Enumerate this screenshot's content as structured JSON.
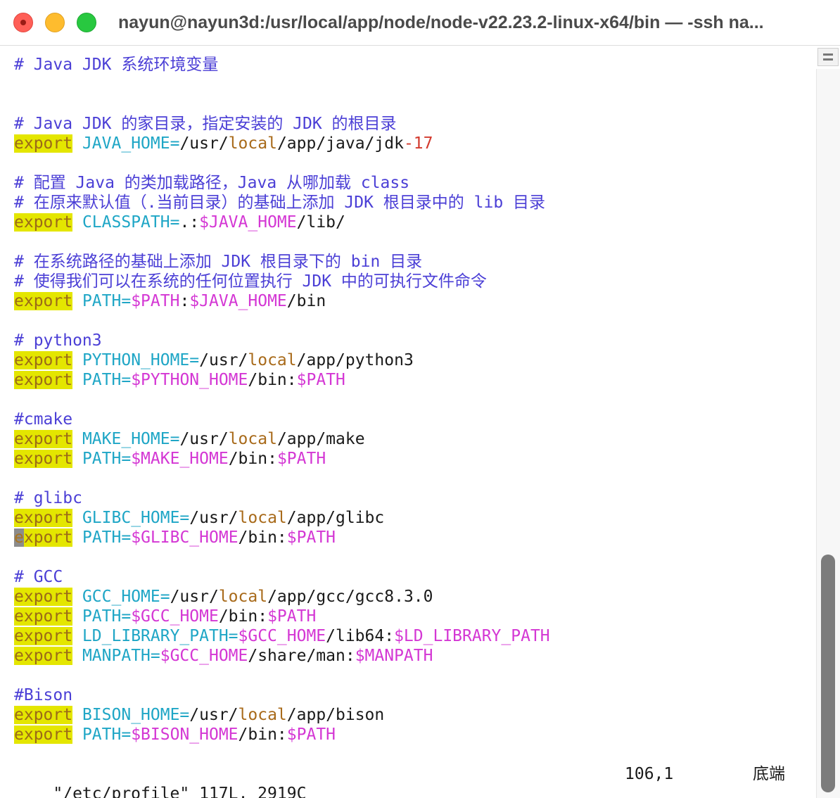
{
  "window": {
    "title": "nayun@nayun3d:/usr/local/app/node/node-v22.23.2-linux-x64/bin — -ssh na..."
  },
  "editor": {
    "lines": [
      [
        {
          "t": "# Java JDK 系统环境变量",
          "k": "c"
        }
      ],
      [],
      [],
      [
        {
          "t": "# Java JDK 的家目录，指定安装的 JDK 的根目录",
          "k": "c"
        }
      ],
      [
        {
          "t": "export",
          "k": "kw"
        },
        {
          "t": " "
        },
        {
          "t": "JAVA_HOME=",
          "k": "var"
        },
        {
          "t": "/usr/"
        },
        {
          "t": "local",
          "k": "lc"
        },
        {
          "t": "/app/java/jdk"
        },
        {
          "t": "-17",
          "k": "num"
        }
      ],
      [],
      [
        {
          "t": "# 配置 Java 的类加载路径，Java 从哪加载 class",
          "k": "c"
        }
      ],
      [
        {
          "t": "# 在原来默认值（.当前目录）的基础上添加 JDK 根目录中的 lib 目录",
          "k": "c"
        }
      ],
      [
        {
          "t": "export",
          "k": "kw"
        },
        {
          "t": " "
        },
        {
          "t": "CLASSPATH=",
          "k": "var"
        },
        {
          "t": ".:"
        },
        {
          "t": "$JAVA_HOME",
          "k": "ref"
        },
        {
          "t": "/lib/"
        }
      ],
      [],
      [
        {
          "t": "# 在系统路径的基础上添加 JDK 根目录下的 bin 目录",
          "k": "c"
        }
      ],
      [
        {
          "t": "# 使得我们可以在系统的任何位置执行 JDK 中的可执行文件命令",
          "k": "c"
        }
      ],
      [
        {
          "t": "export",
          "k": "kw"
        },
        {
          "t": " "
        },
        {
          "t": "PATH=",
          "k": "var"
        },
        {
          "t": "$PATH",
          "k": "ref"
        },
        {
          "t": ":"
        },
        {
          "t": "$JAVA_HOME",
          "k": "ref"
        },
        {
          "t": "/bin"
        }
      ],
      [],
      [
        {
          "t": "# python3",
          "k": "c"
        }
      ],
      [
        {
          "t": "export",
          "k": "kw"
        },
        {
          "t": " "
        },
        {
          "t": "PYTHON_HOME=",
          "k": "var"
        },
        {
          "t": "/usr/"
        },
        {
          "t": "local",
          "k": "lc"
        },
        {
          "t": "/app/python3"
        }
      ],
      [
        {
          "t": "export",
          "k": "kw"
        },
        {
          "t": " "
        },
        {
          "t": "PATH=",
          "k": "var"
        },
        {
          "t": "$PYTHON_HOME",
          "k": "ref"
        },
        {
          "t": "/bin:"
        },
        {
          "t": "$PATH",
          "k": "ref"
        }
      ],
      [],
      [
        {
          "t": "#cmake",
          "k": "c"
        }
      ],
      [
        {
          "t": "export",
          "k": "kw"
        },
        {
          "t": " "
        },
        {
          "t": "MAKE_HOME=",
          "k": "var"
        },
        {
          "t": "/usr/"
        },
        {
          "t": "local",
          "k": "lc"
        },
        {
          "t": "/app/make"
        }
      ],
      [
        {
          "t": "export",
          "k": "kw"
        },
        {
          "t": " "
        },
        {
          "t": "PATH=",
          "k": "var"
        },
        {
          "t": "$MAKE_HOME",
          "k": "ref"
        },
        {
          "t": "/bin:"
        },
        {
          "t": "$PATH",
          "k": "ref"
        }
      ],
      [],
      [
        {
          "t": "# glibc",
          "k": "c"
        }
      ],
      [
        {
          "t": "export",
          "k": "kw"
        },
        {
          "t": " "
        },
        {
          "t": "GLIBC_HOME=",
          "k": "var"
        },
        {
          "t": "/usr/"
        },
        {
          "t": "local",
          "k": "lc"
        },
        {
          "t": "/app/glibc"
        }
      ],
      [
        {
          "t": "e",
          "k": "cursor"
        },
        {
          "t": "xport",
          "k": "kw"
        },
        {
          "t": " "
        },
        {
          "t": "PATH=",
          "k": "var"
        },
        {
          "t": "$GLIBC_HOME",
          "k": "ref"
        },
        {
          "t": "/bin:"
        },
        {
          "t": "$PATH",
          "k": "ref"
        }
      ],
      [],
      [
        {
          "t": "# GCC",
          "k": "c"
        }
      ],
      [
        {
          "t": "export",
          "k": "kw"
        },
        {
          "t": " "
        },
        {
          "t": "GCC_HOME=",
          "k": "var"
        },
        {
          "t": "/usr/"
        },
        {
          "t": "local",
          "k": "lc"
        },
        {
          "t": "/app/gcc/gcc8.3.0"
        }
      ],
      [
        {
          "t": "export",
          "k": "kw"
        },
        {
          "t": " "
        },
        {
          "t": "PATH=",
          "k": "var"
        },
        {
          "t": "$GCC_HOME",
          "k": "ref"
        },
        {
          "t": "/bin:"
        },
        {
          "t": "$PATH",
          "k": "ref"
        }
      ],
      [
        {
          "t": "export",
          "k": "kw"
        },
        {
          "t": " "
        },
        {
          "t": "LD_LIBRARY_PATH=",
          "k": "var"
        },
        {
          "t": "$GCC_HOME",
          "k": "ref"
        },
        {
          "t": "/lib64:"
        },
        {
          "t": "$LD_LIBRARY_PATH",
          "k": "ref"
        }
      ],
      [
        {
          "t": "export",
          "k": "kw"
        },
        {
          "t": " "
        },
        {
          "t": "MANPATH=",
          "k": "var"
        },
        {
          "t": "$GCC_HOME",
          "k": "ref"
        },
        {
          "t": "/share/man:"
        },
        {
          "t": "$MANPATH",
          "k": "ref"
        }
      ],
      [],
      [
        {
          "t": "#Bison",
          "k": "c"
        }
      ],
      [
        {
          "t": "export",
          "k": "kw"
        },
        {
          "t": " "
        },
        {
          "t": "BISON_HOME=",
          "k": "var"
        },
        {
          "t": "/usr/"
        },
        {
          "t": "local",
          "k": "lc"
        },
        {
          "t": "/app/bison"
        }
      ],
      [
        {
          "t": "export",
          "k": "kw"
        },
        {
          "t": " "
        },
        {
          "t": "PATH=",
          "k": "var"
        },
        {
          "t": "$BISON_HOME",
          "k": "ref"
        },
        {
          "t": "/bin:"
        },
        {
          "t": "$PATH",
          "k": "ref"
        }
      ]
    ]
  },
  "status": {
    "file": "\"/etc/profile\" 117L, 2919C",
    "position": "106,1",
    "where": "底端"
  },
  "colors": {
    "comment": "#4b3fd6",
    "keyword_bg": "#e4e600",
    "keyword_fg": "#9b6a18",
    "variable": "#1fa6c6",
    "reference": "#d437d4",
    "local": "#a86a1a",
    "number": "#d33a2e"
  },
  "scrollbar": {
    "position_fraction": 0.9
  }
}
